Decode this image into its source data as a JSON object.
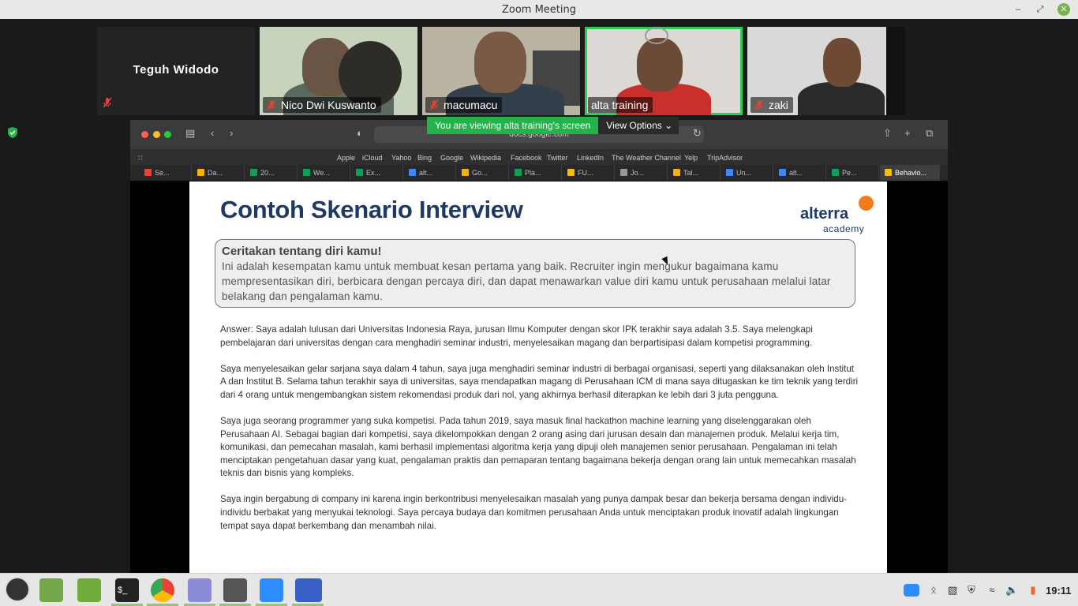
{
  "window": {
    "title": "Zoom Meeting"
  },
  "participants": [
    {
      "name": "Teguh Widodo",
      "muted": true
    },
    {
      "name": "Nico Dwi Kuswanto",
      "muted": true
    },
    {
      "name": "macumacu",
      "muted": true
    },
    {
      "name": "alta training",
      "muted": false,
      "active_speaker": true
    },
    {
      "name": "zaki",
      "muted": true
    }
  ],
  "share_banner": {
    "viewing_text": "You are viewing alta training's screen",
    "view_options": "View Options"
  },
  "browser": {
    "url": "docs.google.com",
    "favorites": [
      "Apple",
      "iCloud",
      "Yahoo",
      "Bing",
      "Google",
      "Wikipedia",
      "Facebook",
      "Twitter",
      "LinkedIn",
      "The Weather Channel",
      "Yelp",
      "TripAdvisor"
    ],
    "tabs": [
      "Se...",
      "Da...",
      "20...",
      "We...",
      "Ex...",
      "alt...",
      "Go...",
      "Pla...",
      "FU...",
      "Jo...",
      "Tal...",
      "Un...",
      "alt...",
      "Pe...",
      "Behavio..."
    ]
  },
  "document": {
    "title": "Contoh Skenario Interview",
    "brand": "alterra",
    "brand_sub": "academy",
    "question_title": "Ceritakan tentang diri kamu!",
    "question_text": "Ini adalah kesempatan kamu untuk membuat kesan pertama yang baik. Recruiter ingin mengukur bagaimana kamu mempresentasikan diri, berbicara dengan percaya diri, dan dapat menawarkan value diri kamu untuk perusahaan melalui latar belakang dan pengalaman kamu.",
    "answers": [
      "Answer: Saya adalah lulusan dari Universitas Indonesia Raya, jurusan Ilmu Komputer dengan skor IPK terakhir saya adalah 3.5. Saya melengkapi pembelajaran dari universitas dengan cara menghadiri seminar industri, menyelesaikan magang dan berpartisipasi dalam kompetisi programming.",
      "Saya menyelesaikan gelar sarjana saya dalam 4 tahun, saya juga menghadiri seminar industri di berbagai organisasi, seperti yang dilaksanakan oleh Institut A dan Institut B. Selama tahun terakhir saya di universitas, saya mendapatkan magang di Perusahaan ICM di mana saya ditugaskan ke tim teknik yang terdiri dari 4 orang untuk mengembangkan sistem rekomendasi produk dari nol, yang akhirnya berhasil diterapkan ke lebih dari 3 juta pengguna.",
      "Saya juga seorang programmer yang suka kompetisi. Pada tahun 2019, saya masuk final hackathon machine learning yang diselenggarakan oleh Perusahaan AI. Sebagai bagian dari kompetisi, saya dikelompokkan dengan 2 orang asing dari jurusan desain dan manajemen produk. Melalui kerja tim, komunikasi, dan pemecahan masalah, kami berhasil implementasi algoritma kerja yang dipuji oleh manajemen senior perusahaan. Pengalaman ini telah menciptakan pengetahuan dasar yang kuat, pengalaman praktis dan pemaparan tentang bagaimana bekerja dengan orang lain untuk memecahkan masalah teknis dan bisnis yang kompleks.",
      "Saya ingin bergabung di company ini karena ingin berkontribusi menyelesaikan masalah yang punya dampak besar dan bekerja bersama dengan individu-individu berbakat yang menyukai teknologi. Saya percaya budaya dan komitmen perusahaan Anda untuk menciptakan produk inovatif adalah lingkungan tempat saya dapat berkembang dan menambah nilai."
    ]
  },
  "taskbar": {
    "clock": "19:11"
  },
  "colors": {
    "active_speaker": "#2dcc5a",
    "share_banner": "#23b34a",
    "doc_title": "#1f3864",
    "brand_accent": "#f47a20"
  }
}
